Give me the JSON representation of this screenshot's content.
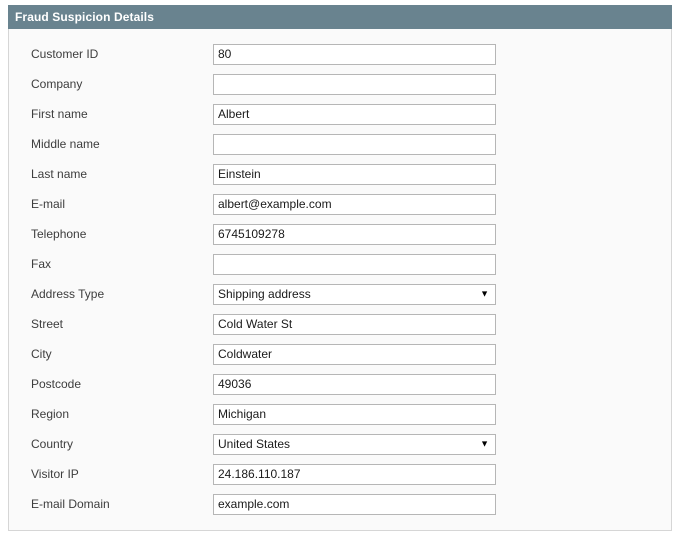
{
  "panel": {
    "title": "Fraud Suspicion Details",
    "header_bg": "#69838f",
    "body_bg": "#fafafa",
    "border_color": "#d6d6d6",
    "input_border_color": "#b6b6b6"
  },
  "fields": [
    {
      "label": "Customer ID",
      "value": "80",
      "type": "text",
      "placeholder": ""
    },
    {
      "label": "Company",
      "value": "",
      "type": "text",
      "placeholder": ""
    },
    {
      "label": "First name",
      "value": "Albert",
      "type": "text",
      "placeholder": ""
    },
    {
      "label": "Middle name",
      "value": "",
      "type": "text",
      "placeholder": ""
    },
    {
      "label": "Last name",
      "value": "Einstein",
      "type": "text",
      "placeholder": ""
    },
    {
      "label": "E-mail",
      "value": "albert@example.com",
      "type": "text",
      "placeholder": ""
    },
    {
      "label": "Telephone",
      "value": "6745109278",
      "type": "text",
      "placeholder": ""
    },
    {
      "label": "Fax",
      "value": "",
      "type": "text",
      "placeholder": ""
    },
    {
      "label": "Address Type",
      "value": "Shipping address",
      "type": "select",
      "placeholder": "",
      "arrow": "▼"
    },
    {
      "label": "Street",
      "value": "Cold Water St",
      "type": "text",
      "placeholder": ""
    },
    {
      "label": "City",
      "value": "Coldwater",
      "type": "text",
      "placeholder": ""
    },
    {
      "label": "Postcode",
      "value": "49036",
      "type": "text",
      "placeholder": ""
    },
    {
      "label": "Region",
      "value": "Michigan",
      "type": "text",
      "placeholder": ""
    },
    {
      "label": "Country",
      "value": "United States",
      "type": "select",
      "placeholder": "",
      "arrow": "▼"
    },
    {
      "label": "Visitor IP",
      "value": "24.186.110.187",
      "type": "text",
      "placeholder": ""
    },
    {
      "label": "E-mail Domain",
      "value": "example.com",
      "type": "text",
      "placeholder": ""
    }
  ]
}
